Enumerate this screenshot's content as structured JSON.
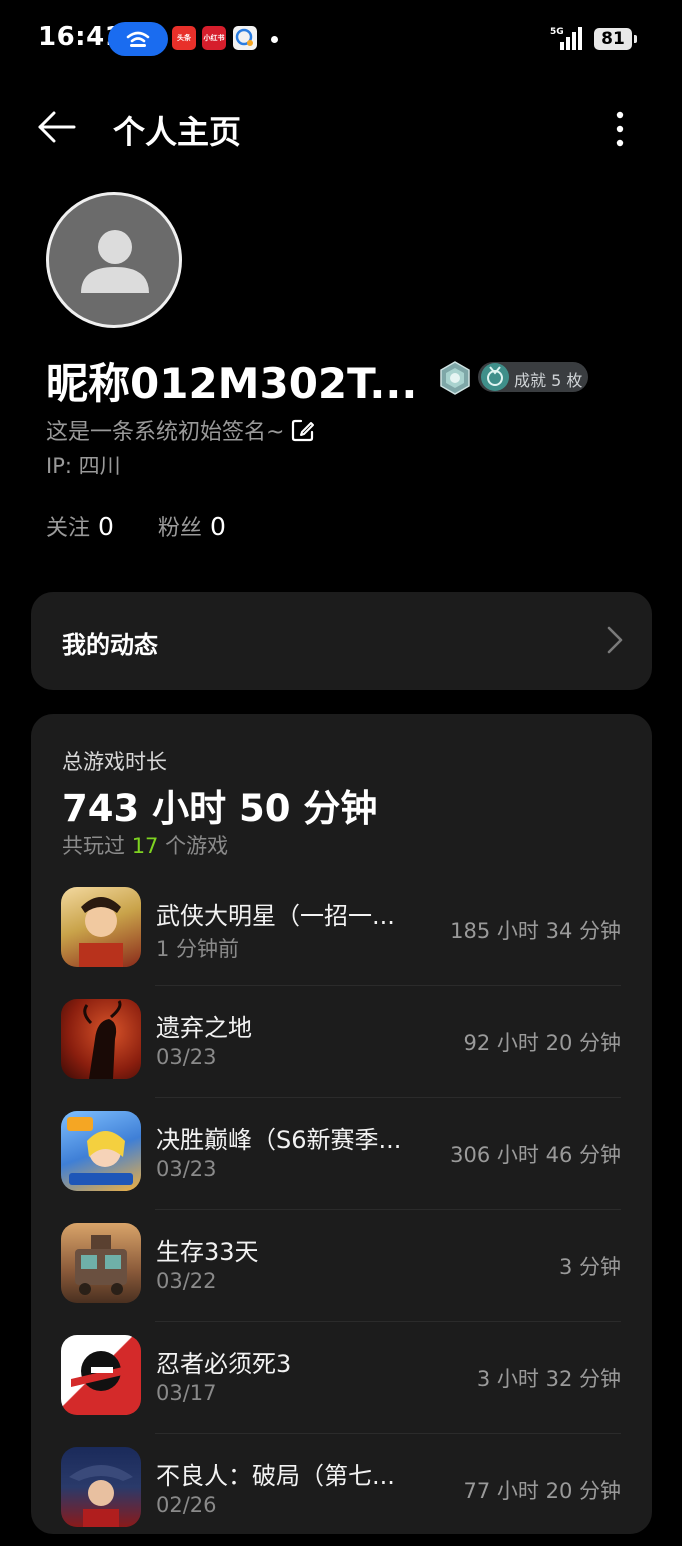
{
  "status_bar": {
    "time": "16:41",
    "notifications": [
      "头条",
      "小红书"
    ],
    "network": "5G",
    "battery": "81"
  },
  "header": {
    "title": "个人主页"
  },
  "profile": {
    "nickname": "昵称012M302T...",
    "achievement_badge": "成就 5 枚",
    "signature": "这是一条系统初始签名~",
    "ip": "IP: 四川",
    "following_label": "关注",
    "following_count": "0",
    "followers_label": "粉丝",
    "followers_count": "0"
  },
  "my_posts": {
    "label": "我的动态"
  },
  "games": {
    "total_label": "总游戏时长",
    "total_value": "743 小时 50 分钟",
    "played_prefix": "共玩过",
    "played_count": "17",
    "played_suffix": "个游戏",
    "items": [
      {
        "name": "武侠大明星（一招一...",
        "date": "1 分钟前",
        "time": "185 小时 34 分钟",
        "icon": "wuxia-game-icon",
        "color": "#c9a34a"
      },
      {
        "name": "遗弃之地",
        "date": "03/23",
        "time": "92 小时 20 分钟",
        "icon": "abandoned-land-game-icon",
        "color": "#b23a1e"
      },
      {
        "name": "决胜巅峰（S6新赛季...",
        "date": "03/23",
        "time": "306 小时 46 分钟",
        "icon": "peak-moba-game-icon",
        "color": "#3f7fd6"
      },
      {
        "name": "生存33天",
        "date": "03/22",
        "time": "3 分钟",
        "icon": "survive-33-days-game-icon",
        "color": "#8a5a3a"
      },
      {
        "name": "忍者必须死3",
        "date": "03/17",
        "time": "3 小时 32 分钟",
        "icon": "ninja-must-die-game-icon",
        "color": "#d42a2a"
      },
      {
        "name": "不良人：破局（第七...",
        "date": "02/26",
        "time": "77 小时 20 分钟",
        "icon": "buliangren-game-icon",
        "color": "#2a3a6a"
      }
    ]
  },
  "colors": {
    "background": "#000000",
    "card": "#1c1c1c",
    "accent_blue": "#1a6cf0",
    "count_green": "#7ed321"
  }
}
